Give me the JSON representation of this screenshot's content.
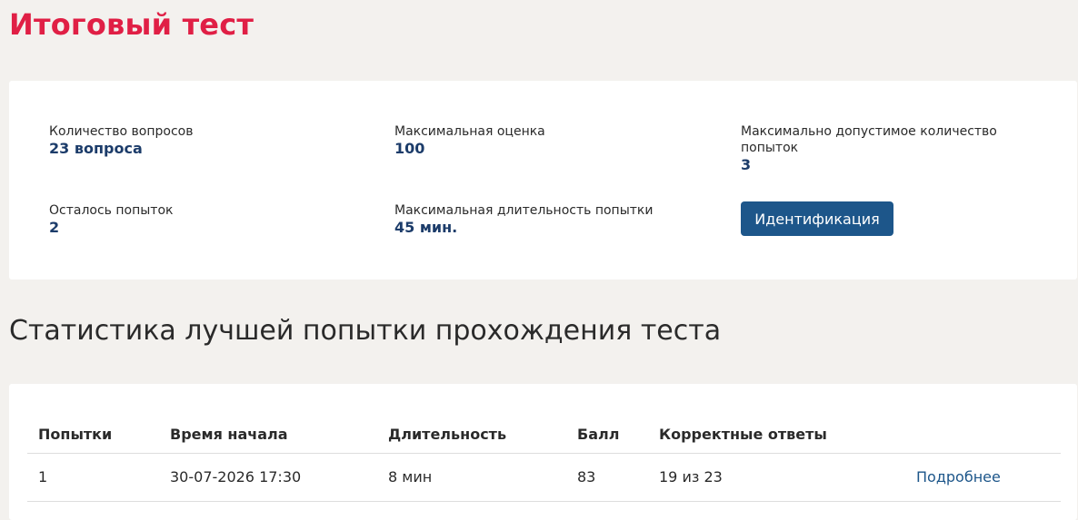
{
  "page": {
    "title": "Итоговый тест"
  },
  "info": {
    "questions_label": "Количество вопросов",
    "questions_value": "23 вопроса",
    "max_score_label": "Максимальная оценка",
    "max_score_value": "100",
    "max_attempts_label": "Максимально допустимое количество попыток",
    "max_attempts_value": "3",
    "attempts_left_label": "Осталось попыток",
    "attempts_left_value": "2",
    "max_duration_label": "Максимальная длительность попытки",
    "max_duration_value": "45 мин.",
    "identify_button": "Идентификация"
  },
  "stats": {
    "title": "Статистика лучшей попытки прохождения теста",
    "columns": [
      "Попытки",
      "Время начала",
      "Длительность",
      "Балл",
      "Корректные ответы",
      ""
    ],
    "rows": [
      {
        "attempt": "1",
        "start": "30-07-2026 17:30",
        "duration": "8 мин",
        "score": "83",
        "correct": "19 из 23",
        "link": "Подробнее"
      }
    ]
  }
}
